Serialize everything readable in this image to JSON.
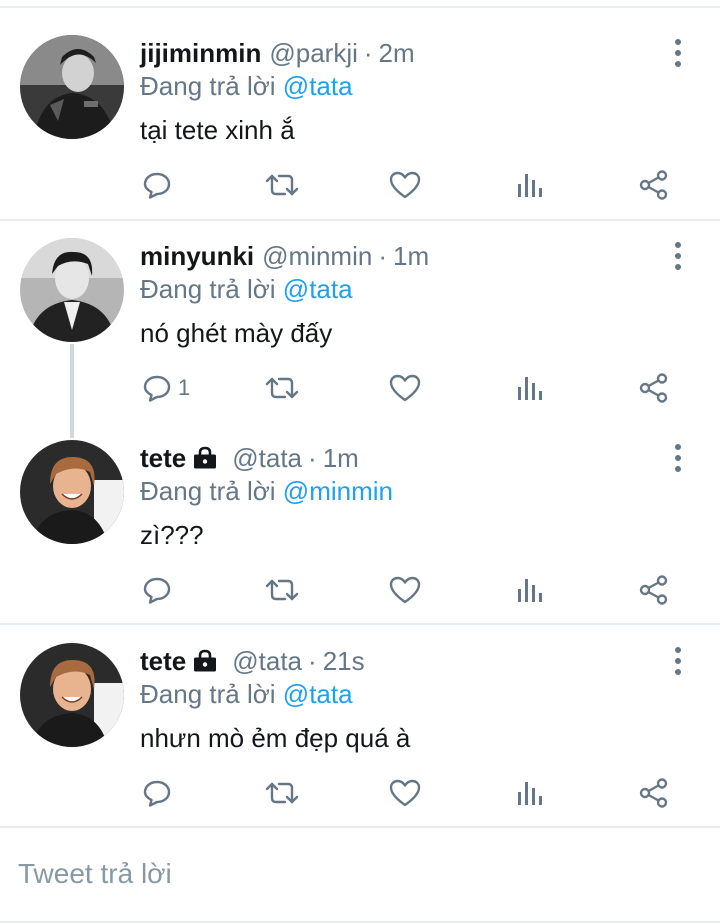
{
  "tweets": [
    {
      "name": "jijiminmin",
      "handle": "@parkji",
      "dot": "·",
      "time": "2m",
      "replying_prefix": "Đang trả lời",
      "replying_to": "@tata",
      "text": "tại tete xinh ắ",
      "reply_count": "",
      "avatar": "dark-grayscale-portrait"
    },
    {
      "name": "minyunki",
      "handle": "@minmin",
      "dot": "·",
      "time": "1m",
      "replying_prefix": "Đang trả lời",
      "replying_to": "@tata",
      "text": "nó ghét mày đấy",
      "reply_count": "1",
      "avatar": "grayscale-portrait"
    },
    {
      "name": "tete",
      "handle": "@tata",
      "dot": "·",
      "time": "1m",
      "replying_prefix": "Đang trả lời",
      "replying_to": "@minmin",
      "text": "zì???",
      "reply_count": "",
      "avatar": "smiling-portrait",
      "locked": true
    },
    {
      "name": "tete",
      "handle": "@tata",
      "dot": "·",
      "time": "21s",
      "replying_prefix": "Đang trả lời",
      "replying_to": "@tata",
      "text": "nhưn mò ẻm đẹp quá à",
      "reply_count": "",
      "avatar": "smiling-portrait",
      "locked": true
    }
  ],
  "reply_input": {
    "placeholder": "Tweet trả lời"
  },
  "icons": {
    "reply": "reply-icon",
    "retweet": "retweet-icon",
    "like": "heart-icon",
    "analytics": "analytics-icon",
    "share": "share-icon",
    "more": "more-vertical-icon",
    "lock": "lock-icon"
  },
  "colors": {
    "mention": "#1da1f2",
    "secondary_text": "#657786",
    "divider": "#e6ecf0",
    "thread_line": "#cfd9de"
  }
}
